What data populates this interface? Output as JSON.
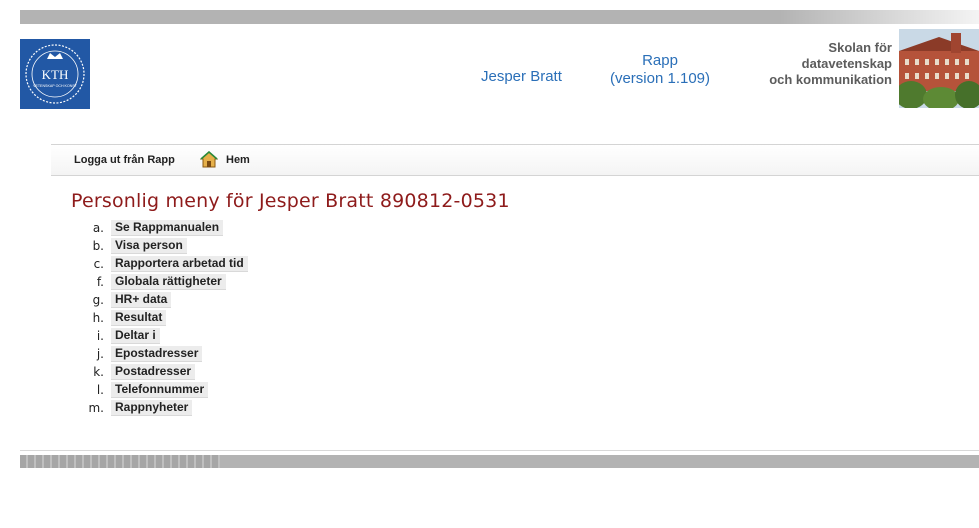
{
  "header": {
    "logo_text": "KTH",
    "logo_subtext": "VETENSKAP OCH KONST",
    "user_name": "Jesper Bratt",
    "app_name": "Rapp",
    "app_version": "(version 1.109)",
    "school_line1": "Skolan för",
    "school_line2": "datavetenskap",
    "school_line3": "och kommunikation"
  },
  "nav": {
    "logout_label": "Logga ut från Rapp",
    "home_label": "Hem"
  },
  "page_title": "Personlig meny för Jesper Bratt 890812-0531",
  "menu": [
    {
      "letter": "a.",
      "label": "Se Rappmanualen"
    },
    {
      "letter": "b.",
      "label": "Visa person"
    },
    {
      "letter": "c.",
      "label": "Rapportera arbetad tid"
    },
    {
      "letter": "f.",
      "label": "Globala rättigheter"
    },
    {
      "letter": "g.",
      "label": "HR+ data"
    },
    {
      "letter": "h.",
      "label": "Resultat"
    },
    {
      "letter": "i.",
      "label": "Deltar i"
    },
    {
      "letter": "j.",
      "label": "Epostadresser"
    },
    {
      "letter": "k.",
      "label": "Postadresser"
    },
    {
      "letter": "l.",
      "label": "Telefonnummer"
    },
    {
      "letter": "m.",
      "label": "Rappnyheter"
    }
  ],
  "colors": {
    "title": "#8e1b1b",
    "link_blue": "#2a6fb8",
    "logo_blue": "#2258a5"
  },
  "icons": {
    "home": "home-icon",
    "logo": "kth-logo"
  }
}
